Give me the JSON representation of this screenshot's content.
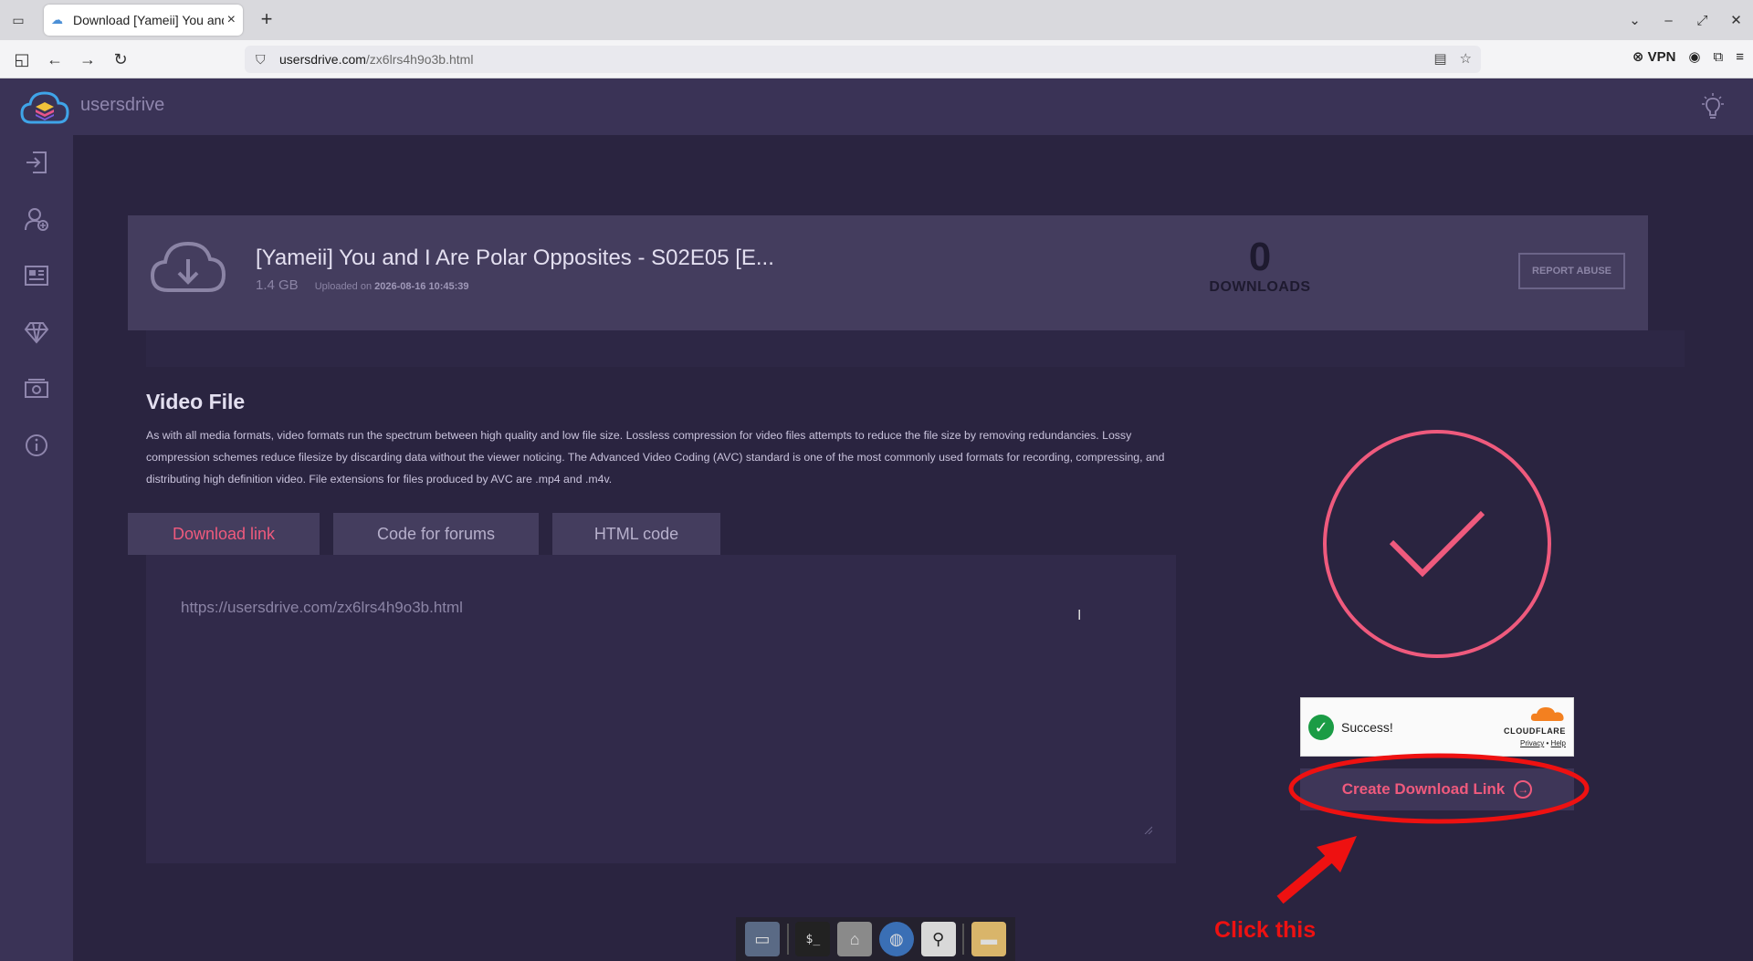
{
  "browser": {
    "tab_title": "Download [Yameii] You and I Are Polar Opposites",
    "tab_close": "×",
    "new_tab": "+",
    "url_host": "usersdrive.com",
    "url_path": "/zx6lrs4h9o3b.html",
    "vpn_label": "VPN"
  },
  "site": {
    "brand": "usersdrive"
  },
  "file": {
    "title": "[Yameii] You and I Are Polar Opposites - S02E05 [E...",
    "size": "1.4 GB",
    "uploaded_prefix": "Uploaded on",
    "uploaded_date": "2026-08-16 10:45:39",
    "downloads_count": "0",
    "downloads_label": "DOWNLOADS",
    "report_label": "REPORT ABUSE"
  },
  "section": {
    "title": "Video File",
    "description": "As with all media formats, video formats run the spectrum between high quality and low file size. Lossless compression for video files attempts to reduce the file size by removing redundancies. Lossy compression schemes reduce filesize by discarding data without the viewer noticing. The Advanced Video Coding (AVC) standard is one of the most commonly used formats for recording, compressing, and distributing high definition video. File extensions for files produced by AVC are .mp4 and .m4v."
  },
  "tabs": [
    {
      "label": "Download link",
      "active": true
    },
    {
      "label": "Code for forums",
      "active": false
    },
    {
      "label": "HTML code",
      "active": false
    }
  ],
  "link_box": {
    "value": "https://usersdrive.com/zx6lrs4h9o3b.html"
  },
  "captcha": {
    "status": "Success!",
    "provider": "CLOUDFLARE",
    "privacy": "Privacy",
    "help": "Help",
    "separator": "•"
  },
  "create_button": {
    "label": "Create Download Link"
  },
  "annotation": {
    "text": "Click this"
  },
  "colors": {
    "accent": "#ef5a7d",
    "annotation": "#ee1111",
    "page_bg": "#2a2440",
    "panel_bg": "#443d5e"
  }
}
